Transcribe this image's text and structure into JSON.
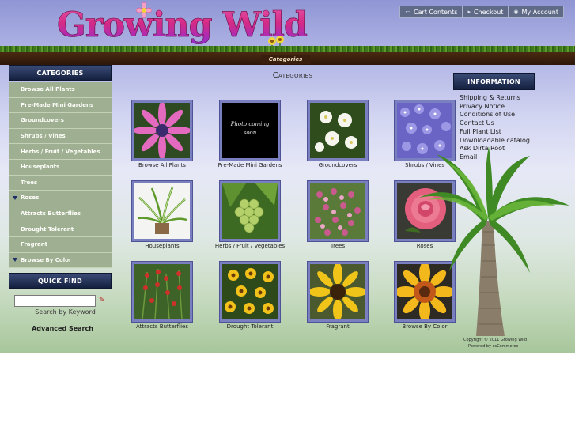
{
  "site": {
    "logo_text": "Growing Wild"
  },
  "topnav": [
    {
      "label": "Cart Contents",
      "icon": "cart-icon"
    },
    {
      "label": "Checkout",
      "icon": "arrow-right-icon"
    },
    {
      "label": "My Account",
      "icon": "person-icon"
    }
  ],
  "breadcrumb": "Categories",
  "sidebar": {
    "categories_heading": "CATEGORIES",
    "items": [
      {
        "label": "Browse All Plants"
      },
      {
        "label": "Pre-Made Mini Gardens"
      },
      {
        "label": "Groundcovers"
      },
      {
        "label": "Shrubs / Vines"
      },
      {
        "label": "Herbs / Fruit / Vegetables"
      },
      {
        "label": "Houseplants"
      },
      {
        "label": "Trees"
      },
      {
        "label": "Roses"
      },
      {
        "label": "Attracts Butterflies"
      },
      {
        "label": "Drought Tolerant"
      },
      {
        "label": "Fragrant"
      },
      {
        "label": "Browse By Color"
      }
    ],
    "quickfind_heading": "QUICK FIND",
    "search_value": "",
    "search_label": "Search by Keyword",
    "advanced_search": "Advanced Search"
  },
  "main": {
    "title": "Categories",
    "tiles": [
      {
        "caption": "Browse All Plants"
      },
      {
        "caption": "Pre-Made Mini Gardens",
        "image_text_1": "Photo coming",
        "image_text_2": "soon"
      },
      {
        "caption": "Groundcovers"
      },
      {
        "caption": "Shrubs / Vines"
      },
      {
        "caption": "Houseplants"
      },
      {
        "caption": "Herbs / Fruit / Vegetables"
      },
      {
        "caption": "Trees"
      },
      {
        "caption": "Roses"
      },
      {
        "caption": "Attracts Butterflies"
      },
      {
        "caption": "Drought Tolerant"
      },
      {
        "caption": "Fragrant"
      },
      {
        "caption": "Browse By Color"
      }
    ]
  },
  "information": {
    "heading": "INFORMATION",
    "links": [
      {
        "label": "Shipping & Returns"
      },
      {
        "label": "Privacy Notice"
      },
      {
        "label": "Conditions of Use"
      },
      {
        "label": "Contact Us"
      },
      {
        "label": "Full Plant List"
      },
      {
        "label": "Downloadable catalog"
      },
      {
        "label": "Ask Dirta Root"
      },
      {
        "label": "Email"
      }
    ]
  },
  "footer": {
    "copyright": "Copyright © 2011 Growing Wild",
    "powered": "Powered by osCommerce"
  },
  "colors": {
    "nav_dark": "#14203f",
    "sidebar_item": "#9fb092",
    "thumb_border": "#7a7fbf",
    "logo_pink": "#d42a86"
  }
}
